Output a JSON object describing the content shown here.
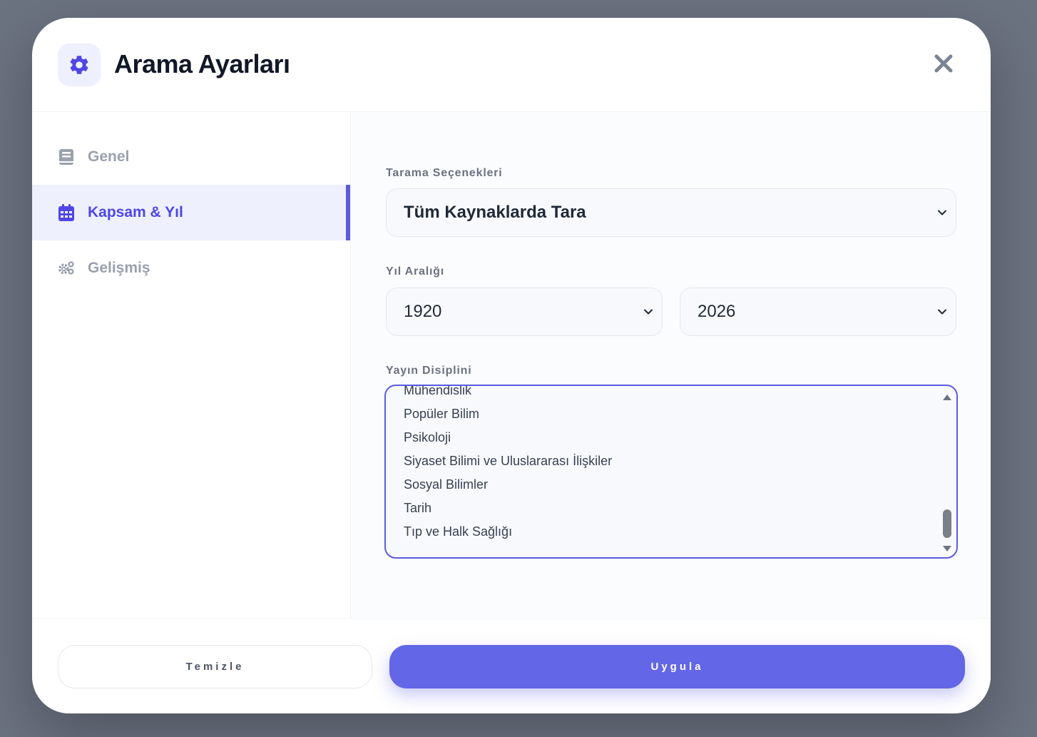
{
  "header": {
    "title": "Arama Ayarları",
    "icon": "gear-icon"
  },
  "sidebar": {
    "items": [
      {
        "label": "Genel",
        "icon": "book-icon",
        "active": false
      },
      {
        "label": "Kapsam & Yıl",
        "icon": "calendar-icon",
        "active": true
      },
      {
        "label": "Gelişmiş",
        "icon": "cogs-icon",
        "active": false
      }
    ]
  },
  "content": {
    "scan": {
      "label": "Tarama Seçenekleri",
      "value": "Tüm Kaynaklarda Tara"
    },
    "years": {
      "label": "Yıl Aralığı",
      "start": "1920",
      "end": "2026"
    },
    "discipline": {
      "label": "Yayın Disiplini",
      "options": [
        "Mühendislik",
        "Popüler Bilim",
        "Psikoloji",
        "Siyaset Bilimi ve Uluslararası İlişkiler",
        "Sosyal Bilimler",
        "Tarih",
        "Tıp ve Halk Sağlığı"
      ]
    }
  },
  "footer": {
    "clear_label": "Temizle",
    "apply_label": "Uygula"
  },
  "colors": {
    "accent": "#5b5be0",
    "apply": "#6366e6",
    "backdrop": "#6b7280"
  }
}
